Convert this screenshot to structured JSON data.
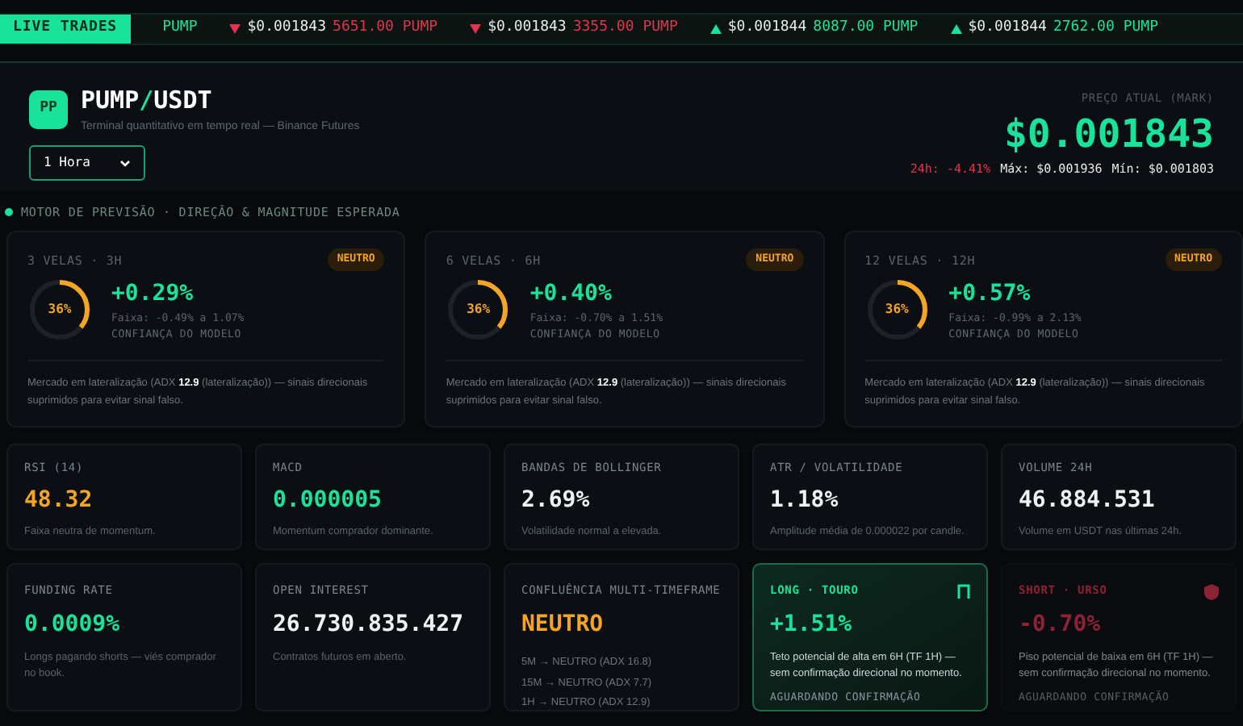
{
  "ticker": {
    "badge": "LIVE TRADES",
    "trades": [
      {
        "kind": "buy",
        "amount": "PUMP"
      },
      {
        "kind": "sell",
        "price": "$0.001843",
        "amount": "5651.00 PUMP"
      },
      {
        "kind": "sell",
        "price": "$0.001843",
        "amount": "3355.00 PUMP"
      },
      {
        "kind": "buy",
        "price": "$0.001844",
        "amount": "8087.00 PUMP"
      },
      {
        "kind": "buy",
        "price": "$0.001844",
        "amount": "2762.00 PUMP"
      }
    ]
  },
  "header": {
    "logo": "PP",
    "base": "PUMP",
    "separator": "/",
    "quote": "USDT",
    "subtitle": "Terminal quantitativo em tempo real — Binance Futures",
    "interval": "1 Hora",
    "price_label": "PREÇO ATUAL (MARK)",
    "price": "$0.001843",
    "change": "24h: -4.41%",
    "high": "Máx: $0.001936",
    "low": "Mín: $0.001803"
  },
  "forecast": {
    "title": "MOTOR DE PREVISÃO · DIREÇÃO & MAGNITUDE ESPERADA",
    "cards": [
      {
        "horizon": "3 VELAS · 3H",
        "badge": "NEUTRO",
        "confidence": "36%",
        "level": 0.36,
        "move": "+0.29%",
        "range": "Faixa: -0.49% a 1.07%",
        "confidence_label": "CONFIANÇA DO MODELO",
        "note": "Mercado em lateralização (ADX **12.9** (lateralização)) — sinais direcionais suprimidos para evitar sinal falso."
      },
      {
        "horizon": "6 VELAS · 6H",
        "badge": "NEUTRO",
        "confidence": "36%",
        "level": 0.36,
        "move": "+0.40%",
        "range": "Faixa: -0.70% a 1.51%",
        "confidence_label": "CONFIANÇA DO MODELO",
        "note": "Mercado em lateralização (ADX **12.9** (lateralização)) — sinais direcionais suprimidos para evitar sinal falso."
      },
      {
        "horizon": "12 VELAS · 12H",
        "badge": "NEUTRO",
        "confidence": "36%",
        "level": 0.36,
        "move": "+0.57%",
        "range": "Faixa: -0.99% a 2.13%",
        "confidence_label": "CONFIANÇA DO MODELO",
        "note": "Mercado em lateralização (ADX **12.9** (lateralização)) — sinais direcionais suprimidos para evitar sinal falso."
      }
    ]
  },
  "metrics": [
    {
      "label": "RSI (14)",
      "value": "48.32",
      "color": "#f5a524",
      "note": "Faixa neutra de momentum."
    },
    {
      "label": "MACD",
      "value": "0.000005",
      "color": "#19e39a",
      "note": "Momentum comprador dominante."
    },
    {
      "label": "BANDAS DE BOLLINGER",
      "value": "2.69%",
      "color": "#eef2f5",
      "note": "Volatilidade normal a elevada."
    },
    {
      "label": "ATR / VOLATILIDADE",
      "value": "1.18%",
      "color": "#eef2f5",
      "note": "Amplitude média de 0.000022 por candle."
    },
    {
      "label": "VOLUME 24H",
      "value": "46.884.531",
      "color": "#eef2f5",
      "note": "Volume em USDT nas últimas 24h."
    }
  ],
  "panels": [
    {
      "kind": "metric",
      "label": "FUNDING RATE",
      "value": "0.0009%",
      "color": "#19e39a",
      "note": "Longs pagando shorts — viés comprador no book."
    },
    {
      "kind": "metric",
      "label": "OPEN INTEREST",
      "value": "26.730.835.427",
      "color": "#eef2f5",
      "note": "Contratos futuros em aberto."
    },
    {
      "kind": "confluence",
      "label": "CONFLUÊNCIA MULTI-TIMEFRAME",
      "value": "NEUTRO",
      "color": "#f5a524",
      "lines": [
        "5M → NEUTRO (ADX 16.8)",
        "15M → NEUTRO (ADX 7.7)",
        "1H → NEUTRO (ADX 12.9)"
      ]
    },
    {
      "kind": "long",
      "active": true,
      "label": "LONG · TOURO",
      "value": "+1.51%",
      "note": "Teto potencial de alta em 6H (TF 1H) — sem confirmação direcional no momento.",
      "status": "AGUARDANDO CONFIRMAÇÃO"
    },
    {
      "kind": "short",
      "active": false,
      "label": "SHORT · URSO",
      "value": "-0.70%",
      "note": "Piso potencial de baixa em 6H (TF 1H) — sem confirmação direcional no momento.",
      "status": "AGUARDANDO CONFIRMAÇÃO"
    }
  ]
}
